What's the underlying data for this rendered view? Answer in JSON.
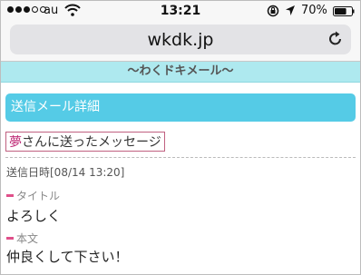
{
  "status_bar": {
    "carrier": "au",
    "time": "13:21",
    "battery": "70%",
    "signal_icon": "signal-dots-icon",
    "wifi_icon": "wifi-icon",
    "orientation_lock_icon": "orientation-lock-icon",
    "location_icon": "location-arrow-icon",
    "battery_icon": "battery-icon",
    "battery_level": 0.7
  },
  "browser": {
    "url": "wkdk.jp",
    "reload_icon": "reload-icon"
  },
  "site": {
    "header": "〜わくドキメール〜"
  },
  "page": {
    "section_title": "送信メール詳細",
    "recipient_name": "夢",
    "heading_suffix": "さんに送ったメッセージ",
    "sent_datetime": "送信日時[08/14 13:20]",
    "title_label": "タイトル",
    "title_value": "よろしく",
    "body_label": "本文",
    "body_value": "仲良くして下さい！"
  },
  "colors": {
    "header_bg": "#aee9ef",
    "section_bg": "#55cbe6",
    "accent_pink": "#e0508a",
    "name_color": "#c0307a"
  }
}
